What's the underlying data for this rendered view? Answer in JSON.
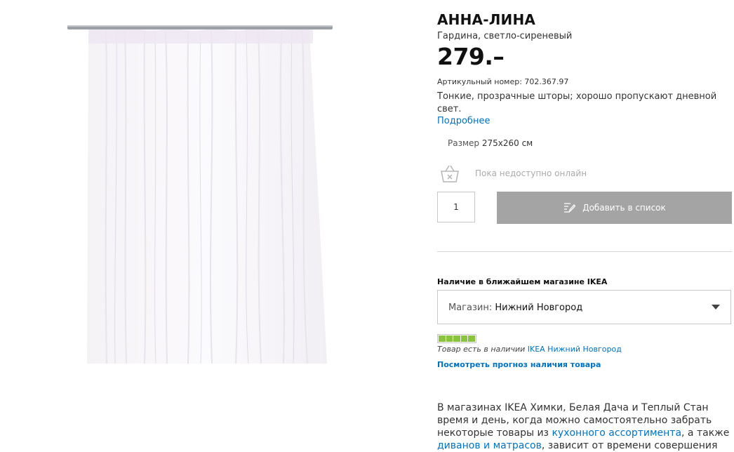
{
  "product": {
    "name": "АННА-ЛИНА",
    "subtitle": "Гардина, светло-сиреневый",
    "price": "279.–",
    "article": "Артикульный номер: 702.367.97",
    "description": "Тонкие, прозрачные шторы; хорошо пропускают дневной свет.",
    "more_link": "Подробнее",
    "size_label": "Размер",
    "size_value": "275x260 см"
  },
  "purchase": {
    "online_status": "Пока недоступно онлайн",
    "quantity": "1",
    "add_button": "Добавить в список"
  },
  "store": {
    "heading": "Наличие в ближайшем магазине IKEA",
    "select_label": "Магазин:",
    "select_value": "Нижний Новгород",
    "stock_level": 5,
    "stock_text": "Товар есть в наличии",
    "stock_store": "IKEA Нижний Новгород",
    "forecast_link": "Посмотреть прогноз наличия товара"
  },
  "info": {
    "text_1": "В магазинах IKEA Химки, Белая Дача и Теплый Стан время и день, когда можно самостоятельно забрать некоторые товары из ",
    "link_1": "кухонного ассортимента",
    "text_2": ", а также ",
    "link_2": "диванов и матрасов",
    "text_3": ", зависит от времени совершения"
  },
  "colors": {
    "link": "#0072c6",
    "button": "#a4a4a4",
    "stock": "#8ac43f",
    "curtain_tint": "#b69ad6"
  }
}
